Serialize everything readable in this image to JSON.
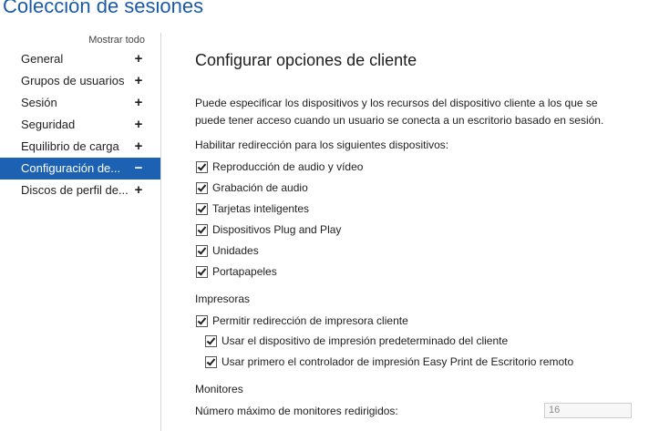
{
  "window": {
    "title": "Colección de sesiones"
  },
  "sidebar": {
    "show_all": "Mostrar todo",
    "items": [
      {
        "label": "General",
        "sign": "+"
      },
      {
        "label": "Grupos de usuarios",
        "sign": "+"
      },
      {
        "label": "Sesión",
        "sign": "+"
      },
      {
        "label": "Seguridad",
        "sign": "+"
      },
      {
        "label": "Equilibrio de carga",
        "sign": "+"
      },
      {
        "label": "Configuración de...",
        "sign": "−"
      },
      {
        "label": "Discos de perfil de...",
        "sign": "+"
      }
    ]
  },
  "main": {
    "title": "Configurar opciones de cliente",
    "description": "Puede especificar los dispositivos y los recursos del dispositivo cliente a los que se puede tener acceso cuando un usuario se conecta a un escritorio basado en sesión.",
    "redirect_label": "Habilitar redirección para los siguientes dispositivos:",
    "devices": [
      {
        "label": "Reproducción de audio y vídeo",
        "checked": true
      },
      {
        "label": "Grabación de audio",
        "checked": true
      },
      {
        "label": "Tarjetas inteligentes",
        "checked": true
      },
      {
        "label": "Dispositivos Plug and Play",
        "checked": true
      },
      {
        "label": "Unidades",
        "checked": true
      },
      {
        "label": "Portapapeles",
        "checked": true
      }
    ],
    "printers_label": "Impresoras",
    "printers": [
      {
        "label": "Permitir redirección de impresora cliente",
        "checked": true
      },
      {
        "label": "Usar el dispositivo de impresión predeterminado del cliente",
        "checked": true
      },
      {
        "label": "Usar primero el controlador de impresión Easy Print de Escritorio remoto",
        "checked": true
      }
    ],
    "monitors_label": "Monitores",
    "max_monitors_label": "Número máximo de monitores redirigidos:",
    "max_monitors_value": "16"
  }
}
